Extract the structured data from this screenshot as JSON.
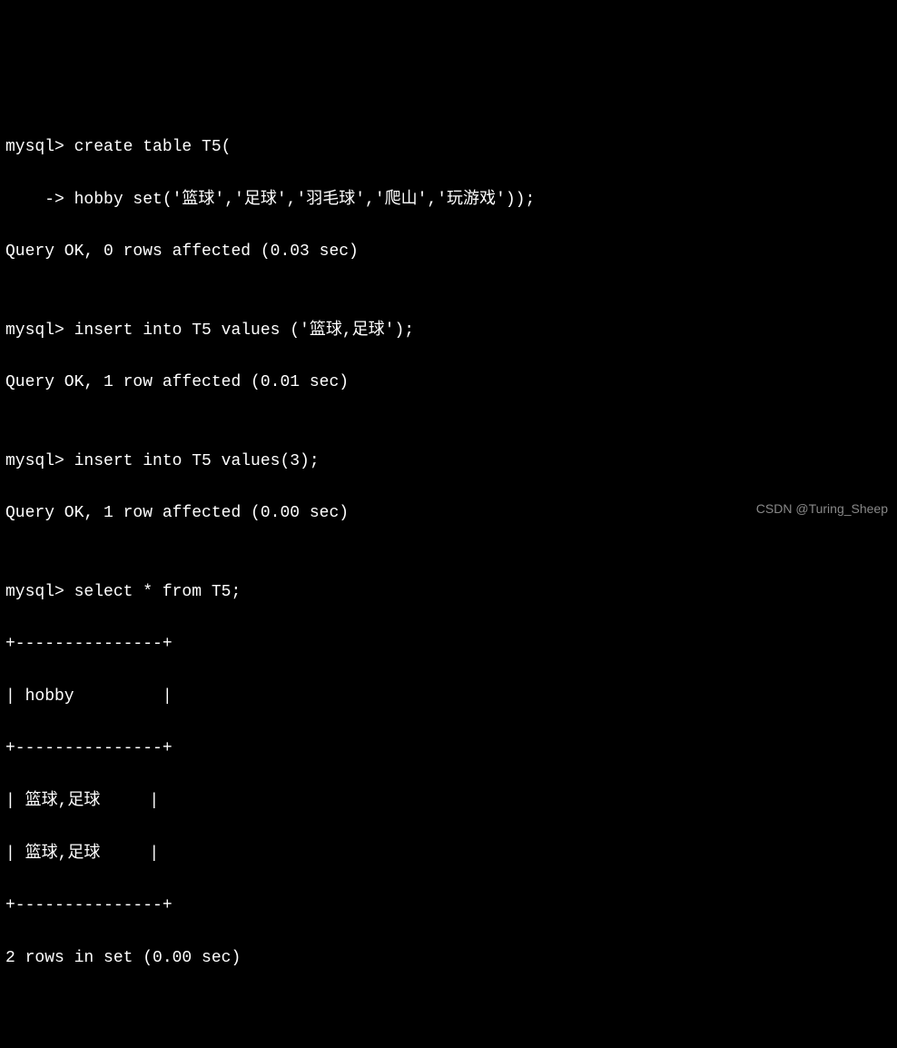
{
  "terminal": {
    "lines": [
      "mysql> create table T5(",
      "    -> hobby set('篮球','足球','羽毛球','爬山','玩游戏'));",
      "Query OK, 0 rows affected (0.03 sec)",
      "",
      "mysql> insert into T5 values ('篮球,足球');",
      "Query OK, 1 row affected (0.01 sec)",
      "",
      "mysql> insert into T5 values(3);",
      "Query OK, 1 row affected (0.00 sec)",
      "",
      "mysql> select * from T5;",
      "+---------------+",
      "| hobby         |",
      "+---------------+",
      "| 篮球,足球     |",
      "| 篮球,足球     |",
      "+---------------+",
      "2 rows in set (0.00 sec)"
    ]
  },
  "watermark": "CSDN @Turing_Sheep"
}
